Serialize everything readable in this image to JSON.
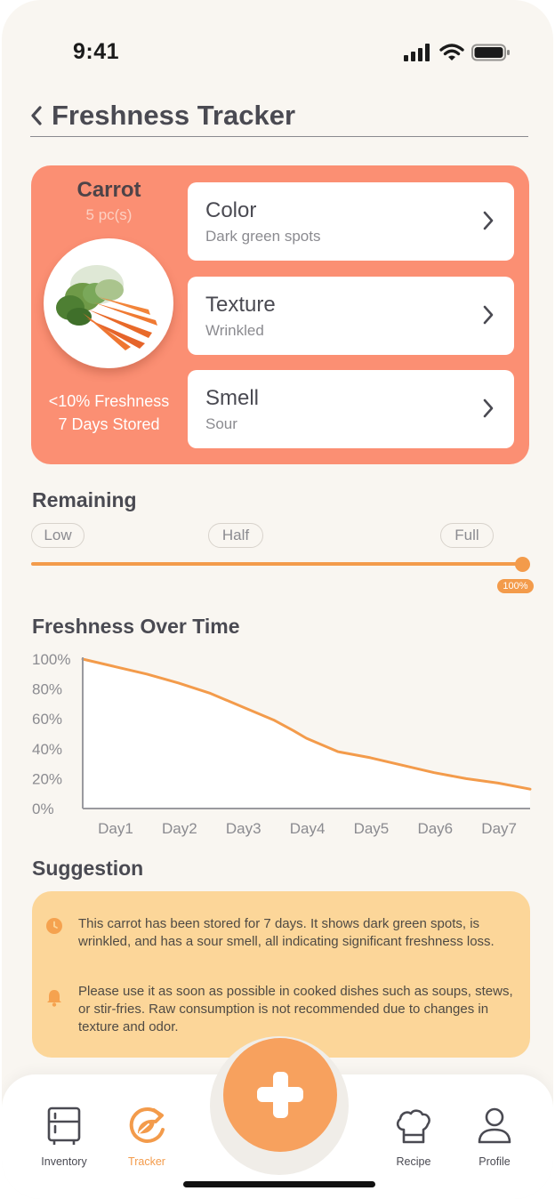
{
  "status_bar": {
    "time": "9:41"
  },
  "header": {
    "title": "Freshness Tracker"
  },
  "item": {
    "name": "Carrot",
    "quantity": "5 pc(s)",
    "freshness_text": "<10% Freshness",
    "stored_text": "7 Days Stored",
    "attributes": [
      {
        "title": "Color",
        "value": "Dark green spots"
      },
      {
        "title": "Texture",
        "value": "Wrinkled"
      },
      {
        "title": "Smell",
        "value": "Sour"
      }
    ]
  },
  "remaining": {
    "title": "Remaining",
    "levels": [
      "Low",
      "Half",
      "Full"
    ],
    "value_label": "100%",
    "value": 1.0
  },
  "chart_data": {
    "type": "line",
    "title": "Freshness Over Time",
    "categories": [
      "Day1",
      "Day2",
      "Day3",
      "Day4",
      "Day5",
      "Day6",
      "Day7"
    ],
    "x": [
      0,
      0.5,
      1,
      1.5,
      2,
      2.5,
      3,
      3.3,
      3.5,
      4,
      4.5,
      5,
      5.5,
      6,
      6.5,
      7
    ],
    "values": [
      100,
      95,
      90,
      84,
      77,
      68,
      59,
      52,
      47,
      38,
      34,
      29,
      24,
      20,
      17,
      13
    ],
    "ytick_labels": [
      "100%",
      "80%",
      "60%",
      "40%",
      "20%",
      "0%"
    ],
    "ylim": [
      0,
      100
    ],
    "color": "#f39b4b",
    "grid": false
  },
  "suggestion": {
    "title": "Suggestion",
    "items": [
      {
        "icon": "clock-icon",
        "text": "This carrot has been stored for 7 days. It shows dark green spots, is wrinkled, and has a sour smell, all indicating significant freshness loss."
      },
      {
        "icon": "bell-icon",
        "text": "Please use it as soon as possible in cooked dishes such as soups, stews, or stir-fries. Raw consumption is not recommended due to changes in texture and odor."
      }
    ]
  },
  "nav": {
    "items": [
      {
        "label": "Inventory",
        "icon": "fridge-icon"
      },
      {
        "label": "Tracker",
        "icon": "tracker-icon",
        "active": true
      },
      {
        "label": "Recipe",
        "icon": "chef-hat-icon"
      },
      {
        "label": "Profile",
        "icon": "user-icon"
      }
    ]
  },
  "colors": {
    "accent": "#f39b4b",
    "card": "#fb8f73",
    "suggestion_bg": "#fcd699",
    "fab": "#f7a15e",
    "background": "#f9f6f1"
  }
}
